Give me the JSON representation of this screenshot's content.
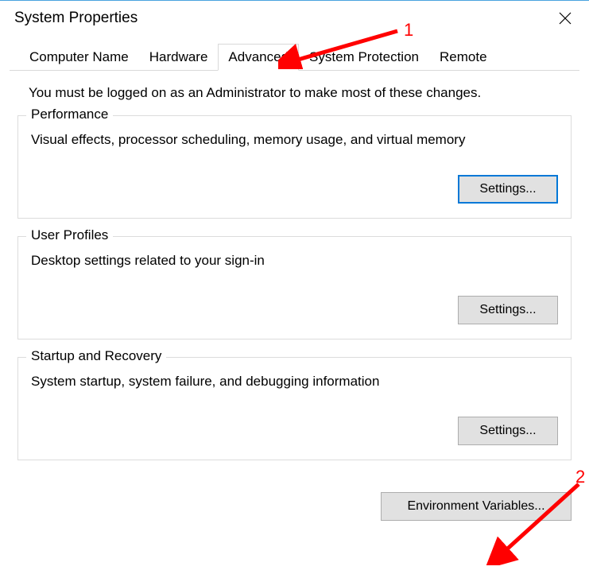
{
  "window": {
    "title": "System Properties"
  },
  "tabs": {
    "computer_name": "Computer Name",
    "hardware": "Hardware",
    "advanced": "Advanced",
    "system_protection": "System Protection",
    "remote": "Remote"
  },
  "intro": "You must be logged on as an Administrator to make most of these changes.",
  "groups": {
    "performance": {
      "legend": "Performance",
      "desc": "Visual effects, processor scheduling, memory usage, and virtual memory",
      "button": "Settings..."
    },
    "user_profiles": {
      "legend": "User Profiles",
      "desc": "Desktop settings related to your sign-in",
      "button": "Settings..."
    },
    "startup": {
      "legend": "Startup and Recovery",
      "desc": "System startup, system failure, and debugging information",
      "button": "Settings..."
    }
  },
  "env_button": "Environment Variables...",
  "annotations": {
    "label1": "1",
    "label2": "2"
  }
}
